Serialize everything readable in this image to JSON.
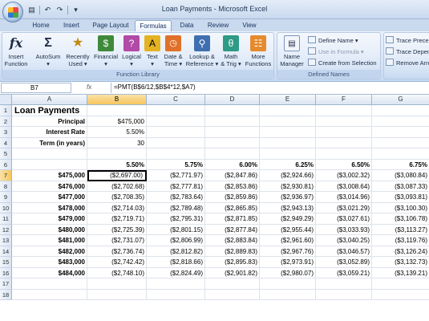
{
  "window": {
    "title": "Loan Payments - Microsoft Excel"
  },
  "tabs": [
    {
      "label": "Home"
    },
    {
      "label": "Insert"
    },
    {
      "label": "Page Layout"
    },
    {
      "label": "Formulas",
      "active": true
    },
    {
      "label": "Data"
    },
    {
      "label": "Review"
    },
    {
      "label": "View"
    }
  ],
  "ribbon": {
    "insert_function": {
      "line1": "Insert",
      "line2": "Function"
    },
    "autosum": {
      "label": "AutoSum",
      "arrow": "▾"
    },
    "recently_used": {
      "line1": "Recently",
      "line2": "Used ▾"
    },
    "financial": {
      "line1": "Financial",
      "line2": "▾"
    },
    "logical": {
      "line1": "Logical",
      "line2": "▾"
    },
    "text": {
      "line1": "Text",
      "line2": "▾"
    },
    "date_time": {
      "line1": "Date &",
      "line2": "Time ▾"
    },
    "lookup": {
      "line1": "Lookup &",
      "line2": "Reference ▾"
    },
    "math": {
      "line1": "Math",
      "line2": "& Trig ▾"
    },
    "more": {
      "line1": "More",
      "line2": "Functions ▾"
    },
    "function_library_label": "Function Library",
    "name_manager": {
      "line1": "Name",
      "line2": "Manager"
    },
    "define_name": "Define Name ▾",
    "use_in_formula": "Use in Formula ▾",
    "create_from_selection": "Create from Selection",
    "defined_names_label": "Defined Names",
    "trace_precedents": "Trace Preced",
    "trace_dependents": "Trace Depen",
    "remove_arrows": "Remove Arro"
  },
  "formula_bar": {
    "name_box": "B7",
    "fx": "fx",
    "formula": "=PMT(B$6/12,$B$4*12,$A7)"
  },
  "columns": [
    "A",
    "B",
    "C",
    "D",
    "E",
    "F",
    "G"
  ],
  "rows": [
    "1",
    "2",
    "3",
    "4",
    "5",
    "6",
    "7",
    "8",
    "9",
    "10",
    "11",
    "12",
    "13",
    "14",
    "15",
    "16",
    "17",
    "18"
  ],
  "sheet": {
    "title": "Loan Payments",
    "inputs": [
      {
        "label": "Principal",
        "value": "$475,000"
      },
      {
        "label": "Interest Rate",
        "value": "5.50%"
      },
      {
        "label": "Term (in years)",
        "value": "30"
      }
    ],
    "rates": [
      "5.50%",
      "5.75%",
      "6.00%",
      "6.25%",
      "6.50%",
      "6.75%"
    ],
    "table": [
      {
        "principal": "$475,000",
        "payments": [
          "($2,697.00)",
          "($2,771.97)",
          "($2,847.86)",
          "($2,924.66)",
          "($3,002.32)",
          "($3,080.84)"
        ]
      },
      {
        "principal": "$476,000",
        "payments": [
          "($2,702.68)",
          "($2,777.81)",
          "($2,853.86)",
          "($2,930.81)",
          "($3,008.64)",
          "($3,087.33)"
        ]
      },
      {
        "principal": "$477,000",
        "payments": [
          "($2,708.35)",
          "($2,783.64)",
          "($2,859.86)",
          "($2,936.97)",
          "($3,014.96)",
          "($3,093.81)"
        ]
      },
      {
        "principal": "$478,000",
        "payments": [
          "($2,714.03)",
          "($2,789.48)",
          "($2,865.85)",
          "($2,943.13)",
          "($3,021.29)",
          "($3,100.30)"
        ]
      },
      {
        "principal": "$479,000",
        "payments": [
          "($2,719.71)",
          "($2,795.31)",
          "($2,871.85)",
          "($2,949.29)",
          "($3,027.61)",
          "($3,106.78)"
        ]
      },
      {
        "principal": "$480,000",
        "payments": [
          "($2,725.39)",
          "($2,801.15)",
          "($2,877.84)",
          "($2,955.44)",
          "($3,033.93)",
          "($3,113.27)"
        ]
      },
      {
        "principal": "$481,000",
        "payments": [
          "($2,731.07)",
          "($2,806.99)",
          "($2,883.84)",
          "($2,961.60)",
          "($3,040.25)",
          "($3,119.76)"
        ]
      },
      {
        "principal": "$482,000",
        "payments": [
          "($2,736.74)",
          "($2,812.82)",
          "($2,889.83)",
          "($2,967.76)",
          "($3,046.57)",
          "($3,126.24)"
        ]
      },
      {
        "principal": "$483,000",
        "payments": [
          "($2,742.42)",
          "($2,818.66)",
          "($2,895.83)",
          "($2,973.91)",
          "($3,052.89)",
          "($3,132.73)"
        ]
      },
      {
        "principal": "$484,000",
        "payments": [
          "($2,748.10)",
          "($2,824.49)",
          "($2,901.82)",
          "($2,980.07)",
          "($3,059.21)",
          "($3,139.21)"
        ]
      }
    ]
  },
  "selection": {
    "active_cell": "B7",
    "selected_column": "B",
    "selected_row": "7"
  },
  "colors": {
    "accent": "#c9d9ee",
    "selected_header": "#f6c65e"
  }
}
